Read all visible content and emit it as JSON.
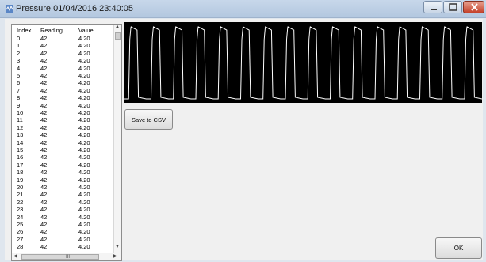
{
  "window": {
    "title": "Pressure 01/04/2016 23:40:05",
    "minimize_icon": "minimize-icon",
    "maximize_icon": "maximize-icon",
    "close_icon": "close-icon"
  },
  "table": {
    "columns": [
      "Index",
      "Reading",
      "Value"
    ],
    "rows": [
      [
        "0",
        "42",
        "4.20"
      ],
      [
        "1",
        "42",
        "4.20"
      ],
      [
        "2",
        "42",
        "4.20"
      ],
      [
        "3",
        "42",
        "4.20"
      ],
      [
        "4",
        "42",
        "4.20"
      ],
      [
        "5",
        "42",
        "4.20"
      ],
      [
        "6",
        "42",
        "4.20"
      ],
      [
        "7",
        "42",
        "4.20"
      ],
      [
        "8",
        "42",
        "4.20"
      ],
      [
        "9",
        "42",
        "4.20"
      ],
      [
        "10",
        "42",
        "4.20"
      ],
      [
        "11",
        "42",
        "4.20"
      ],
      [
        "12",
        "42",
        "4.20"
      ],
      [
        "13",
        "42",
        "4.20"
      ],
      [
        "14",
        "42",
        "4.20"
      ],
      [
        "15",
        "42",
        "4.20"
      ],
      [
        "16",
        "42",
        "4.20"
      ],
      [
        "17",
        "42",
        "4.20"
      ],
      [
        "18",
        "42",
        "4.20"
      ],
      [
        "19",
        "42",
        "4.20"
      ],
      [
        "20",
        "42",
        "4.20"
      ],
      [
        "21",
        "42",
        "4.20"
      ],
      [
        "22",
        "42",
        "4.20"
      ],
      [
        "23",
        "42",
        "4.20"
      ],
      [
        "24",
        "42",
        "4.20"
      ],
      [
        "25",
        "42",
        "4.20"
      ],
      [
        "26",
        "42",
        "4.20"
      ],
      [
        "27",
        "42",
        "4.20"
      ],
      [
        "28",
        "42",
        "4.20"
      ]
    ],
    "hscroll_grip": "III"
  },
  "plot": {
    "pulse_count": 16,
    "background": "#000000",
    "line_color": "#ffffff"
  },
  "buttons": {
    "save_label": "Save to CSV",
    "ok_label": "OK"
  }
}
